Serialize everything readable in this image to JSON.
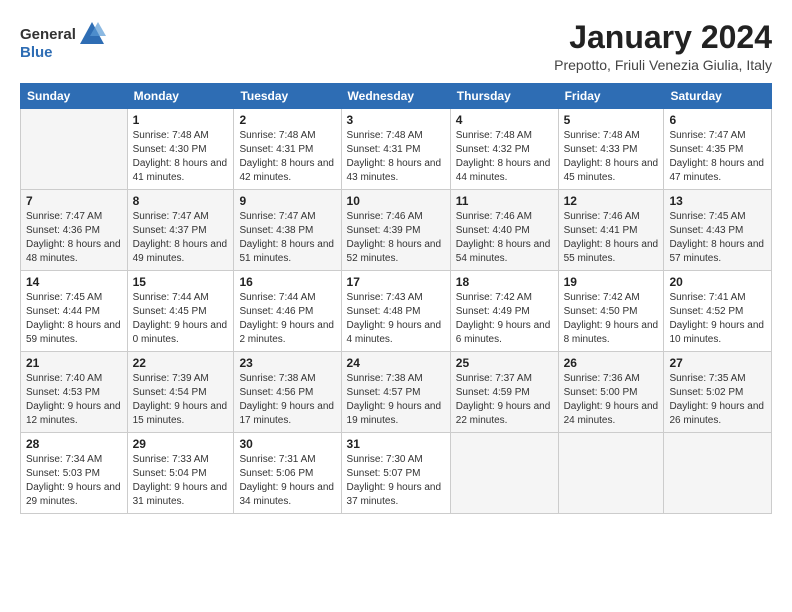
{
  "logo": {
    "line1": "General",
    "line2": "Blue"
  },
  "header": {
    "title": "January 2024",
    "location": "Prepotto, Friuli Venezia Giulia, Italy"
  },
  "weekdays": [
    "Sunday",
    "Monday",
    "Tuesday",
    "Wednesday",
    "Thursday",
    "Friday",
    "Saturday"
  ],
  "weeks": [
    [
      {
        "day": "",
        "sunrise": "",
        "sunset": "",
        "daylight": ""
      },
      {
        "day": "1",
        "sunrise": "Sunrise: 7:48 AM",
        "sunset": "Sunset: 4:30 PM",
        "daylight": "Daylight: 8 hours and 41 minutes."
      },
      {
        "day": "2",
        "sunrise": "Sunrise: 7:48 AM",
        "sunset": "Sunset: 4:31 PM",
        "daylight": "Daylight: 8 hours and 42 minutes."
      },
      {
        "day": "3",
        "sunrise": "Sunrise: 7:48 AM",
        "sunset": "Sunset: 4:31 PM",
        "daylight": "Daylight: 8 hours and 43 minutes."
      },
      {
        "day": "4",
        "sunrise": "Sunrise: 7:48 AM",
        "sunset": "Sunset: 4:32 PM",
        "daylight": "Daylight: 8 hours and 44 minutes."
      },
      {
        "day": "5",
        "sunrise": "Sunrise: 7:48 AM",
        "sunset": "Sunset: 4:33 PM",
        "daylight": "Daylight: 8 hours and 45 minutes."
      },
      {
        "day": "6",
        "sunrise": "Sunrise: 7:47 AM",
        "sunset": "Sunset: 4:35 PM",
        "daylight": "Daylight: 8 hours and 47 minutes."
      }
    ],
    [
      {
        "day": "7",
        "sunrise": "Sunrise: 7:47 AM",
        "sunset": "Sunset: 4:36 PM",
        "daylight": "Daylight: 8 hours and 48 minutes."
      },
      {
        "day": "8",
        "sunrise": "Sunrise: 7:47 AM",
        "sunset": "Sunset: 4:37 PM",
        "daylight": "Daylight: 8 hours and 49 minutes."
      },
      {
        "day": "9",
        "sunrise": "Sunrise: 7:47 AM",
        "sunset": "Sunset: 4:38 PM",
        "daylight": "Daylight: 8 hours and 51 minutes."
      },
      {
        "day": "10",
        "sunrise": "Sunrise: 7:46 AM",
        "sunset": "Sunset: 4:39 PM",
        "daylight": "Daylight: 8 hours and 52 minutes."
      },
      {
        "day": "11",
        "sunrise": "Sunrise: 7:46 AM",
        "sunset": "Sunset: 4:40 PM",
        "daylight": "Daylight: 8 hours and 54 minutes."
      },
      {
        "day": "12",
        "sunrise": "Sunrise: 7:46 AM",
        "sunset": "Sunset: 4:41 PM",
        "daylight": "Daylight: 8 hours and 55 minutes."
      },
      {
        "day": "13",
        "sunrise": "Sunrise: 7:45 AM",
        "sunset": "Sunset: 4:43 PM",
        "daylight": "Daylight: 8 hours and 57 minutes."
      }
    ],
    [
      {
        "day": "14",
        "sunrise": "Sunrise: 7:45 AM",
        "sunset": "Sunset: 4:44 PM",
        "daylight": "Daylight: 8 hours and 59 minutes."
      },
      {
        "day": "15",
        "sunrise": "Sunrise: 7:44 AM",
        "sunset": "Sunset: 4:45 PM",
        "daylight": "Daylight: 9 hours and 0 minutes."
      },
      {
        "day": "16",
        "sunrise": "Sunrise: 7:44 AM",
        "sunset": "Sunset: 4:46 PM",
        "daylight": "Daylight: 9 hours and 2 minutes."
      },
      {
        "day": "17",
        "sunrise": "Sunrise: 7:43 AM",
        "sunset": "Sunset: 4:48 PM",
        "daylight": "Daylight: 9 hours and 4 minutes."
      },
      {
        "day": "18",
        "sunrise": "Sunrise: 7:42 AM",
        "sunset": "Sunset: 4:49 PM",
        "daylight": "Daylight: 9 hours and 6 minutes."
      },
      {
        "day": "19",
        "sunrise": "Sunrise: 7:42 AM",
        "sunset": "Sunset: 4:50 PM",
        "daylight": "Daylight: 9 hours and 8 minutes."
      },
      {
        "day": "20",
        "sunrise": "Sunrise: 7:41 AM",
        "sunset": "Sunset: 4:52 PM",
        "daylight": "Daylight: 9 hours and 10 minutes."
      }
    ],
    [
      {
        "day": "21",
        "sunrise": "Sunrise: 7:40 AM",
        "sunset": "Sunset: 4:53 PM",
        "daylight": "Daylight: 9 hours and 12 minutes."
      },
      {
        "day": "22",
        "sunrise": "Sunrise: 7:39 AM",
        "sunset": "Sunset: 4:54 PM",
        "daylight": "Daylight: 9 hours and 15 minutes."
      },
      {
        "day": "23",
        "sunrise": "Sunrise: 7:38 AM",
        "sunset": "Sunset: 4:56 PM",
        "daylight": "Daylight: 9 hours and 17 minutes."
      },
      {
        "day": "24",
        "sunrise": "Sunrise: 7:38 AM",
        "sunset": "Sunset: 4:57 PM",
        "daylight": "Daylight: 9 hours and 19 minutes."
      },
      {
        "day": "25",
        "sunrise": "Sunrise: 7:37 AM",
        "sunset": "Sunset: 4:59 PM",
        "daylight": "Daylight: 9 hours and 22 minutes."
      },
      {
        "day": "26",
        "sunrise": "Sunrise: 7:36 AM",
        "sunset": "Sunset: 5:00 PM",
        "daylight": "Daylight: 9 hours and 24 minutes."
      },
      {
        "day": "27",
        "sunrise": "Sunrise: 7:35 AM",
        "sunset": "Sunset: 5:02 PM",
        "daylight": "Daylight: 9 hours and 26 minutes."
      }
    ],
    [
      {
        "day": "28",
        "sunrise": "Sunrise: 7:34 AM",
        "sunset": "Sunset: 5:03 PM",
        "daylight": "Daylight: 9 hours and 29 minutes."
      },
      {
        "day": "29",
        "sunrise": "Sunrise: 7:33 AM",
        "sunset": "Sunset: 5:04 PM",
        "daylight": "Daylight: 9 hours and 31 minutes."
      },
      {
        "day": "30",
        "sunrise": "Sunrise: 7:31 AM",
        "sunset": "Sunset: 5:06 PM",
        "daylight": "Daylight: 9 hours and 34 minutes."
      },
      {
        "day": "31",
        "sunrise": "Sunrise: 7:30 AM",
        "sunset": "Sunset: 5:07 PM",
        "daylight": "Daylight: 9 hours and 37 minutes."
      },
      {
        "day": "",
        "sunrise": "",
        "sunset": "",
        "daylight": ""
      },
      {
        "day": "",
        "sunrise": "",
        "sunset": "",
        "daylight": ""
      },
      {
        "day": "",
        "sunrise": "",
        "sunset": "",
        "daylight": ""
      }
    ]
  ]
}
